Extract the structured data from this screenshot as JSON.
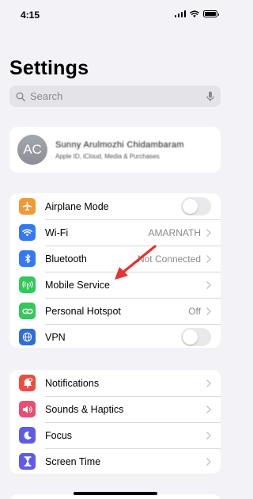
{
  "status_bar": {
    "time": "4:15"
  },
  "page": {
    "title": "Settings"
  },
  "search": {
    "placeholder": "Search"
  },
  "profile": {
    "initials": "AC",
    "name": "Sunny Arulmozhi Chidambaram",
    "subtitle": "Apple ID, iCloud, Media & Purchases"
  },
  "group1": {
    "items": [
      {
        "label": "Airplane Mode",
        "icon": "airplane-icon",
        "color": "#f09a37",
        "toggle": false
      },
      {
        "label": "Wi-Fi",
        "value": "AMARNATH",
        "icon": "wifi-icon",
        "color": "#3478f6"
      },
      {
        "label": "Bluetooth",
        "value": "Not Connected",
        "icon": "bluetooth-icon",
        "color": "#3478f6"
      },
      {
        "label": "Mobile Service",
        "icon": "antenna-icon",
        "color": "#34c759"
      },
      {
        "label": "Personal Hotspot",
        "value": "Off",
        "icon": "hotspot-icon",
        "color": "#34c759"
      },
      {
        "label": "VPN",
        "icon": "globe-icon",
        "color": "#2f6ed8",
        "toggle": false
      }
    ]
  },
  "group2": {
    "items": [
      {
        "label": "Notifications",
        "icon": "bell-icon",
        "color": "#eb4e3d"
      },
      {
        "label": "Sounds & Haptics",
        "icon": "speaker-icon",
        "color": "#eb4e72"
      },
      {
        "label": "Focus",
        "icon": "moon-icon",
        "color": "#5e5ce6"
      },
      {
        "label": "Screen Time",
        "icon": "hourglass-icon",
        "color": "#5e5ce6"
      }
    ]
  },
  "annotation": {
    "color": "#e8322d"
  }
}
